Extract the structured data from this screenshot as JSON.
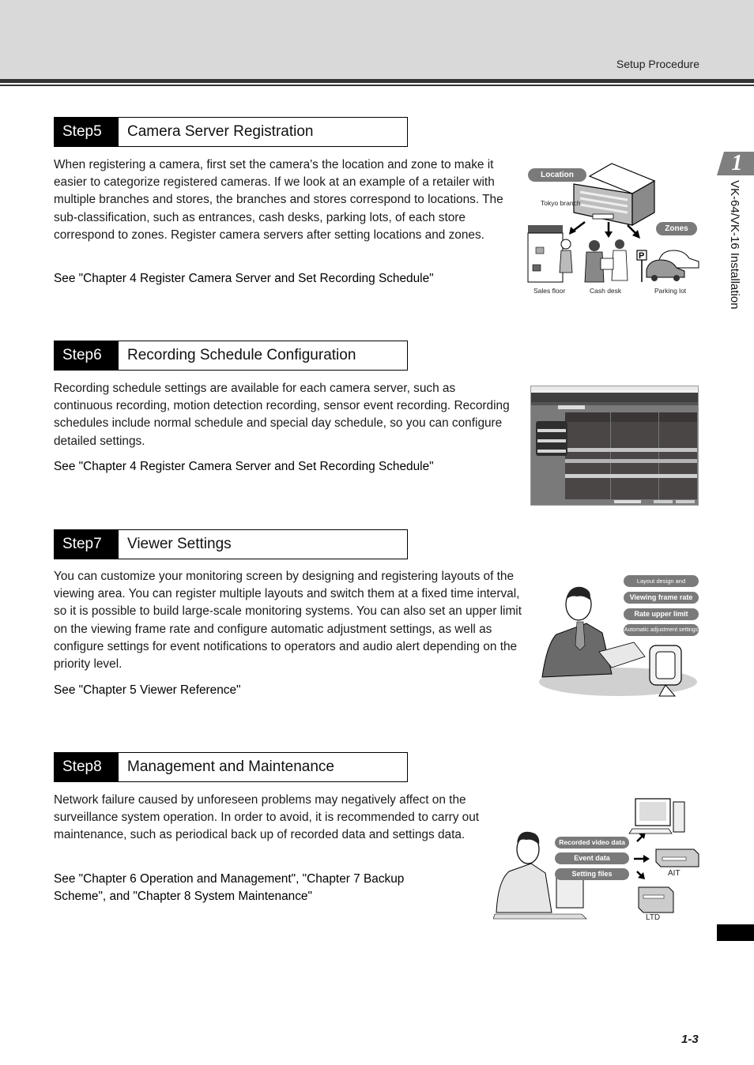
{
  "header": {
    "section_label": "Setup Procedure"
  },
  "sidebar": {
    "chapter_number": "1",
    "chapter_title": "VK-64/VK-16 Installation"
  },
  "footer": {
    "page_number": "1-3"
  },
  "steps": [
    {
      "tag": "Step5",
      "title": "Camera Server Registration",
      "body": "When registering a camera, first set the camera's the location and zone to make it easier to categorize registered cameras. If we look at an example of a retailer with multiple branches and stores, the branches and stores correspond to locations. The sub-classification, such as entrances, cash desks, parking lots, of each store correspond to zones. Register camera servers after setting locations and zones.",
      "reference": "See \"Chapter 4 Register Camera Server and Set Recording Schedule\"",
      "illustration": {
        "location_label": "Location",
        "branch_label": "Tokyo branch",
        "zones_label": "Zones",
        "zone_captions": [
          "Sales floor",
          "Cash desk",
          "Parking lot"
        ],
        "parking_sign": "P"
      }
    },
    {
      "tag": "Step6",
      "title": "Recording Schedule Configuration",
      "body": "Recording schedule settings are available for each camera server, such as continuous recording, motion detection recording, sensor event recording. Recording schedules include normal schedule and special day schedule, so you can configure detailed settings.",
      "reference": "See \"Chapter 4 Register Camera Server and Set Recording Schedule\"",
      "screenshot": {
        "window_title": "Network Video Recorder - Storage Server",
        "panel_title": "Configuration and Preferences",
        "days": [
          "Monday",
          "Tuesday",
          "Wednesday"
        ],
        "groups": [
          "NK Store",
          "Entrance",
          "Cash desk",
          "Parking"
        ],
        "cameras": [
          "Camera1",
          "Camera2",
          "Camera3"
        ]
      }
    },
    {
      "tag": "Step7",
      "title": "Viewer Settings",
      "body": "You can customize your monitoring screen by designing and registering layouts of the viewing area. You can register multiple layouts and switch them at a fixed time interval, so it is possible to build large-scale monitoring systems. You can also set an upper limit on the viewing frame rate and configure automatic adjustment settings, as well as configure settings for event notifications to operators and audio alert depending on the priority level.",
      "reference": "See \"Chapter 5 Viewer Reference\"",
      "illustration": {
        "labels": [
          "Layout design and registration",
          "Viewing frame rate",
          "Rate upper limit",
          "Automatic adjustment settings"
        ]
      }
    },
    {
      "tag": "Step8",
      "title": "Management and Maintenance",
      "body": "Network failure caused by unforeseen problems may negatively affect on the surveillance system operation. In order to avoid, it is recommended to carry out maintenance, such as periodical back up of recorded data and settings data.",
      "reference": "See \"Chapter 6 Operation and Management\", \"Chapter 7 Backup Scheme\", and \"Chapter 8 System Maintenance\"",
      "illustration": {
        "labels": [
          "Recorded video data",
          "Event data",
          "Setting files"
        ],
        "device_labels": [
          "AIT",
          "LTD"
        ]
      }
    }
  ]
}
